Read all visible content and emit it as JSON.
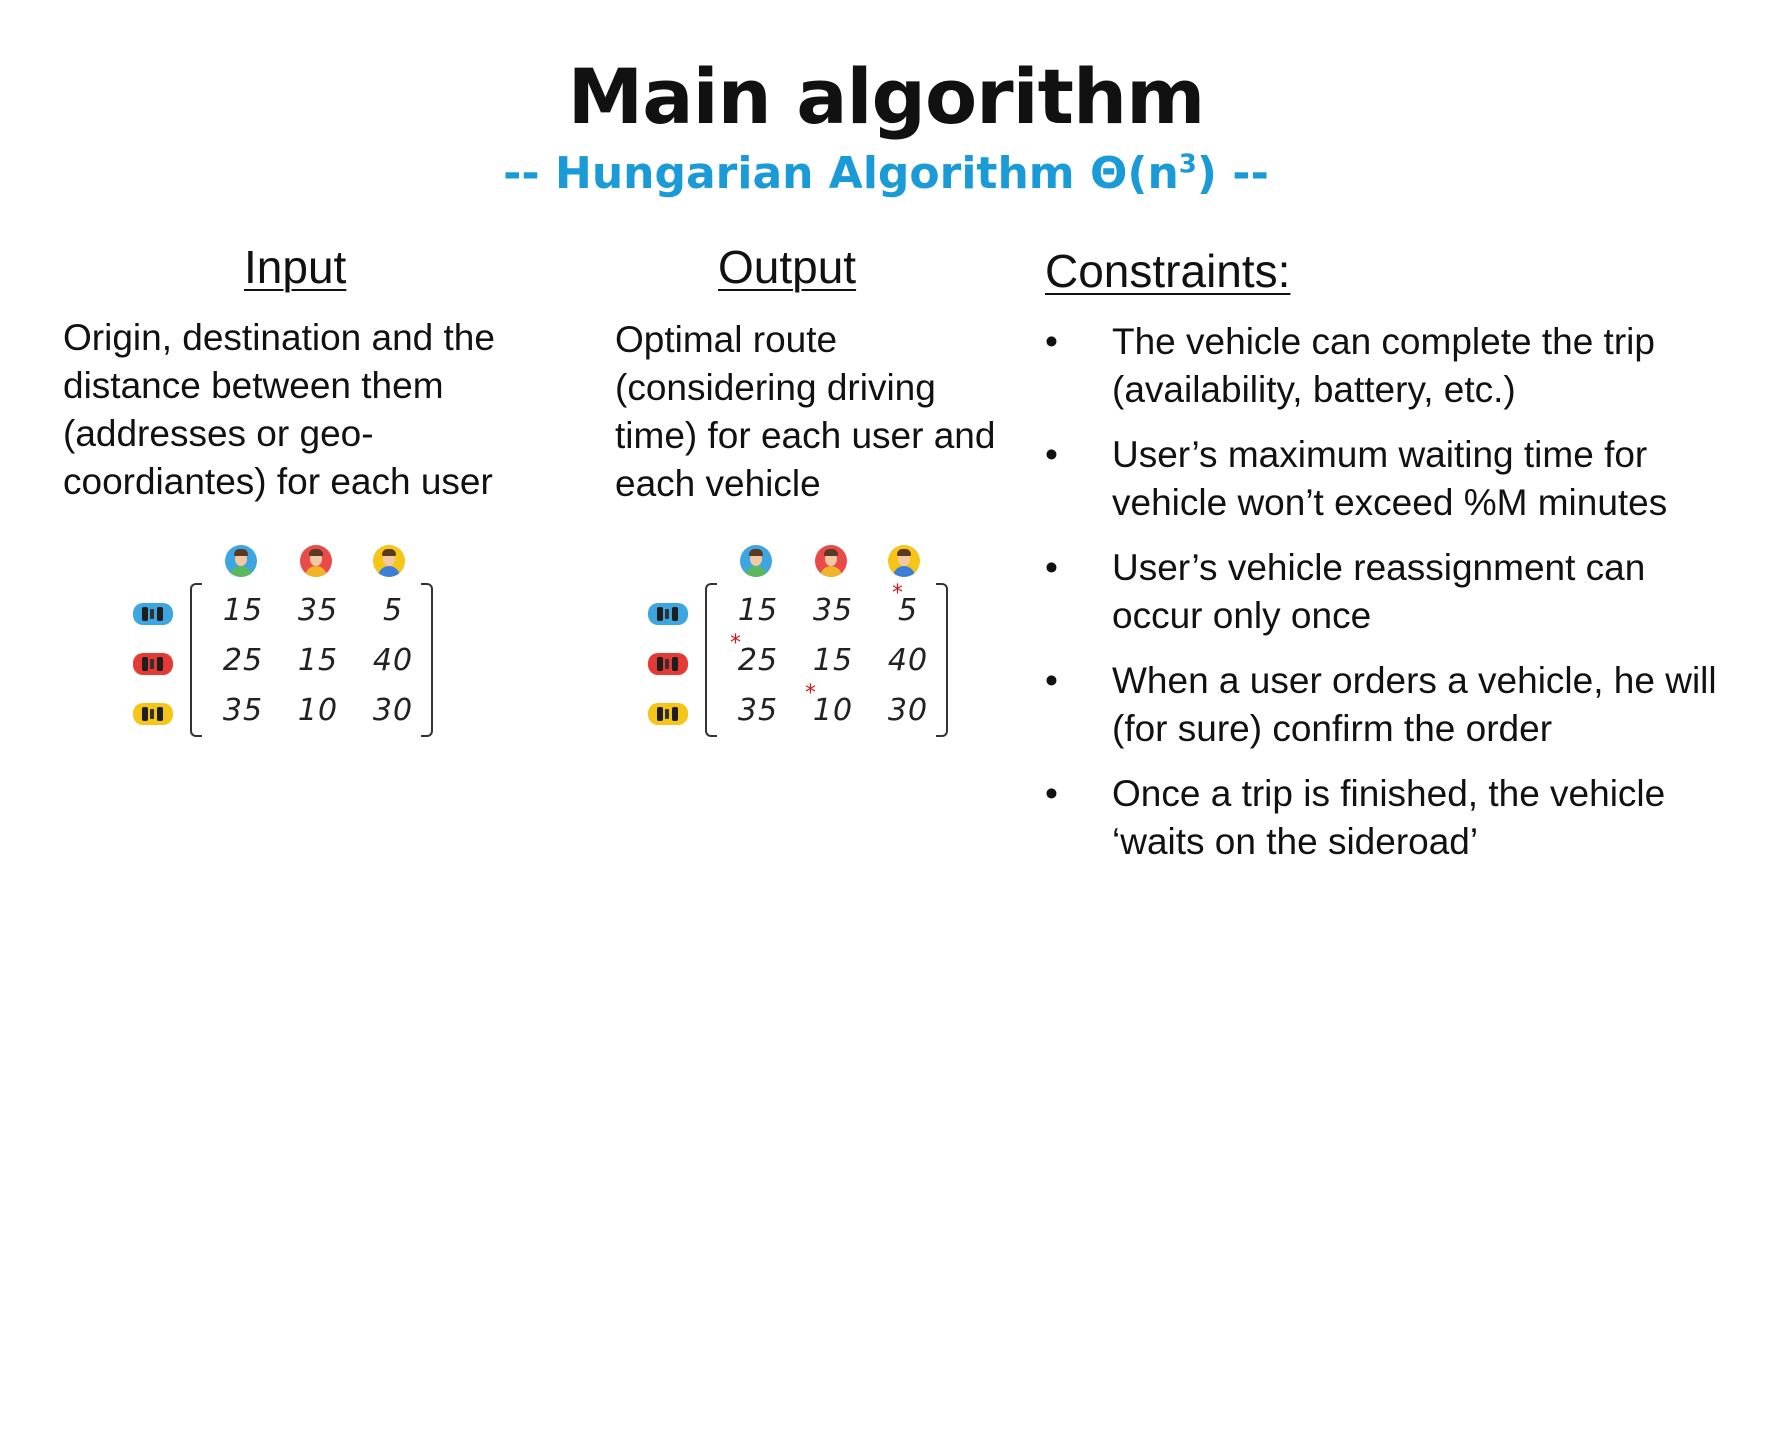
{
  "title": "Main algorithm",
  "subtitle": {
    "prefix": "-- Hungarian Algorithm ",
    "complexity_base": "Θ(n",
    "complexity_exp": "3",
    "suffix": ") --"
  },
  "input": {
    "heading": "Input",
    "text": "Origin, destination and the distance between them (addresses or geo-coordiantes) for each user"
  },
  "output": {
    "heading": "Output",
    "text": "Optimal route (considering driving time) for each user and each vehicle"
  },
  "constraints": {
    "heading": "Constraints:",
    "bullet": "•",
    "items": [
      "The vehicle can complete the trip (availability, battery, etc.)",
      "User’s maximum waiting time for vehicle won’t exceed %M minutes",
      "User’s vehicle reassignment can occur only once",
      "When a user orders a vehicle, he will (for sure) confirm the order",
      "Once a trip is finished, the vehicle ‘waits on the sideroad’"
    ]
  },
  "matrix": {
    "users": [
      {
        "icon": "user-avatar-icon",
        "ring": "#3da5e0",
        "shirt": "#5cb85c"
      },
      {
        "icon": "user-avatar-icon",
        "ring": "#e94b4b",
        "shirt": "#f0b429"
      },
      {
        "icon": "user-avatar-icon",
        "ring": "#f5c518",
        "shirt": "#3d7fd6"
      }
    ],
    "vehicles": [
      {
        "icon": "car-icon",
        "color": "#3da5e0"
      },
      {
        "icon": "car-icon",
        "color": "#e53935"
      },
      {
        "icon": "car-icon",
        "color": "#f5c518"
      }
    ],
    "values": [
      [
        "15",
        "35",
        "5"
      ],
      [
        "25",
        "15",
        "40"
      ],
      [
        "35",
        "10",
        "30"
      ]
    ],
    "star_symbol": "*",
    "selected": [
      [
        0,
        2
      ],
      [
        1,
        0
      ],
      [
        2,
        1
      ]
    ],
    "star_color": "#d11a1a"
  },
  "colors": {
    "accent": "#1a9ad6",
    "text": "#111111"
  }
}
